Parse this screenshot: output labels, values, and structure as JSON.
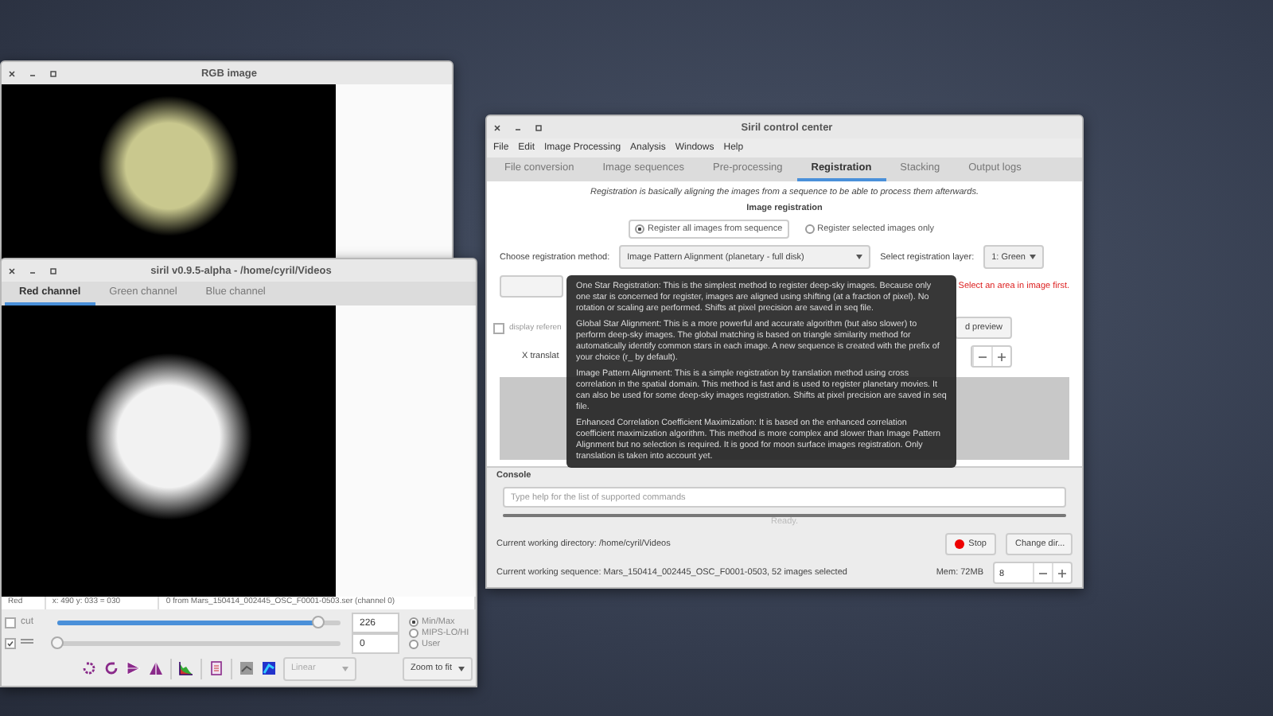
{
  "rgb_window": {
    "title": "RGB image"
  },
  "channel_window": {
    "title": "siril v0.9.5-alpha - /home/cyril/Videos",
    "tabs": [
      {
        "label": "Red channel",
        "selected": true
      },
      {
        "label": "Green channel",
        "selected": false
      },
      {
        "label": "Blue channel",
        "selected": false
      }
    ],
    "status": [
      "Red",
      "x: 490 y: 033 = 030",
      "0 from Mars_150414_002445_OSC_F0001-0503.ser (channel 0)"
    ],
    "sliders": [
      {
        "kind": "cut",
        "label": "cut",
        "checked": false,
        "level": 0.92,
        "value": "226"
      },
      {
        "kind": "gamma",
        "checked": true,
        "level": 0,
        "value": "0"
      }
    ],
    "range_modes": [
      {
        "label": "Min/Max",
        "selected": true
      },
      {
        "label": "MIPS-LO/HI",
        "selected": false
      },
      {
        "label": "User",
        "selected": false
      }
    ],
    "scale": "Linear",
    "zoom": "Zoom to fit"
  },
  "control_center": {
    "title": "Siril control center",
    "menu": [
      "File",
      "Edit",
      "Image Processing",
      "Analysis",
      "Windows",
      "Help"
    ],
    "tabs": [
      {
        "label": "File conversion",
        "selected": false
      },
      {
        "label": "Image sequences",
        "selected": false
      },
      {
        "label": "Pre-processing",
        "selected": false
      },
      {
        "label": "Registration",
        "selected": true
      },
      {
        "label": "Stacking",
        "selected": false
      },
      {
        "label": "Output logs",
        "selected": false
      }
    ],
    "intro": "Registration is basically aligning the images from a sequence to be able to process them afterwards.",
    "section": "Image registration",
    "register_options": [
      {
        "label": "Register all images from sequence",
        "selected": true
      },
      {
        "label": "Register selected images only",
        "selected": false
      }
    ],
    "method_label": "Choose registration method:",
    "method": "Image Pattern Alignment (planetary - full disk)",
    "layer_label": "Select registration layer:",
    "layer": "1: Green",
    "warning": "Select an area in image first.",
    "display_reference": {
      "label": "display referen",
      "checked": false
    },
    "x_translation": "X translat",
    "preview_button": "d preview",
    "console_label": "Console",
    "console_placeholder": "Type help for the list of supported commands",
    "progress": {
      "level": 1
    },
    "progress_text": "Ready.",
    "cwd": "Current working directory: /home/cyril/Videos",
    "stop": "Stop",
    "change_dir": "Change dir...",
    "sequence": "Current working sequence: Mars_150414_002445_OSC_F0001-0503, 52 images selected",
    "mem": "Mem: 72MB",
    "threads": "8",
    "tooltip": [
      "One Star Registration: This is the simplest method to register deep-sky images. Because only one star is concerned for register, images are aligned using shifting (at a fraction of pixel). No rotation or scaling are performed. Shifts at pixel precision are saved in seq file.",
      "Global Star Alignment: This is a more powerful and accurate algorithm (but also slower) to perform deep-sky images. The global matching is based on triangle similarity method for automatically identify common stars in each image. A new sequence is created with the prefix of your choice (r_ by default).",
      "Image Pattern Alignment: This is a simple registration by translation method using cross correlation in the spatial domain. This method is fast and is used to register planetary movies. It can also be used for some deep-sky images registration. Shifts at pixel precision are saved in seq file.",
      "Enhanced Correlation Coefficient Maximization: It is based on the enhanced correlation coefficient maximization algorithm. This method is more complex and slower than Image Pattern Alignment but no selection is required. It is good for moon surface images registration. Only translation is taken into account yet."
    ]
  }
}
